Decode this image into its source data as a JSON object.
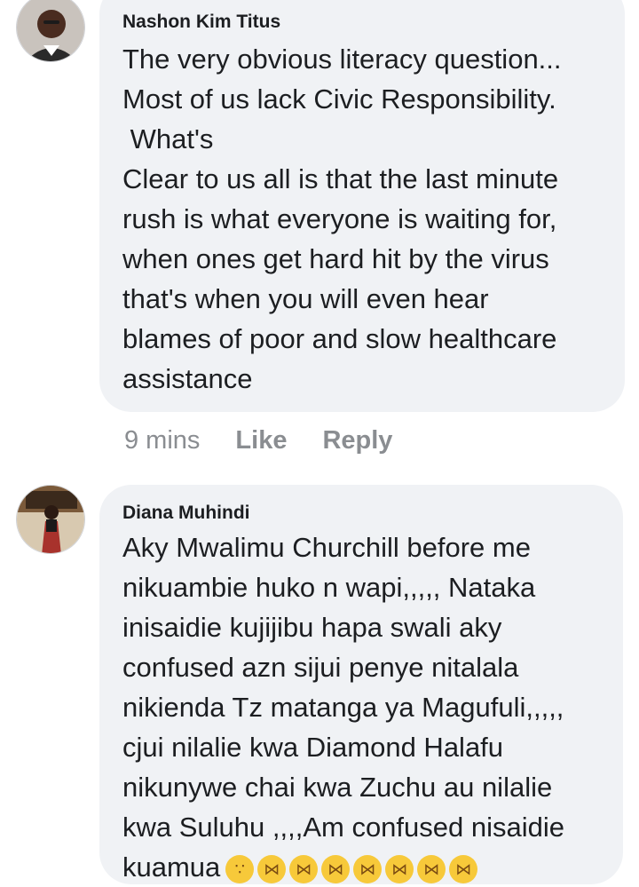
{
  "comments": [
    {
      "author": "Nashon Kim Titus",
      "text": "The very obvious literacy question...\nMost of us lack Civic Responsibility.\n What's\nClear to us all is that the last minute\nrush is what everyone is waiting for,\nwhen ones get hard hit by the virus\nthat's when you will even hear\nblames of poor and slow healthcare\nassistance",
      "time": "9 mins",
      "like_label": "Like",
      "reply_label": "Reply",
      "avatar_icon": "user-photo-icon"
    },
    {
      "author": "Diana Muhindi",
      "text": "Aky Mwalimu Churchill before me\nnikuambie huko n wapi,,,,, Nataka\ninisaidie kujijibu hapa swali aky\nconfused azn sijui penye nitalala\nnikienda Tz matanga ya Magufuli,,,,,\ncjui nilalie kwa Diamond Halafu\nnikunywe chai kwa Zuchu au nilalie\nkwa Suluhu ,,,,Am confused nisaidie\nkuamua",
      "emojis": [
        "thinking-face",
        "grinning-squinting-face",
        "grinning-squinting-face",
        "grinning-squinting-face",
        "face-with-tears-of-joy",
        "rolling-on-floor-laughing",
        "rolling-on-floor-laughing",
        "face-with-tears-of-joy"
      ],
      "avatar_icon": "user-photo-icon"
    }
  ],
  "colors": {
    "bubble": "#f0f2f5",
    "text": "#1c1e21",
    "meta": "#8a8d91",
    "emoji": "#f7c93a"
  }
}
